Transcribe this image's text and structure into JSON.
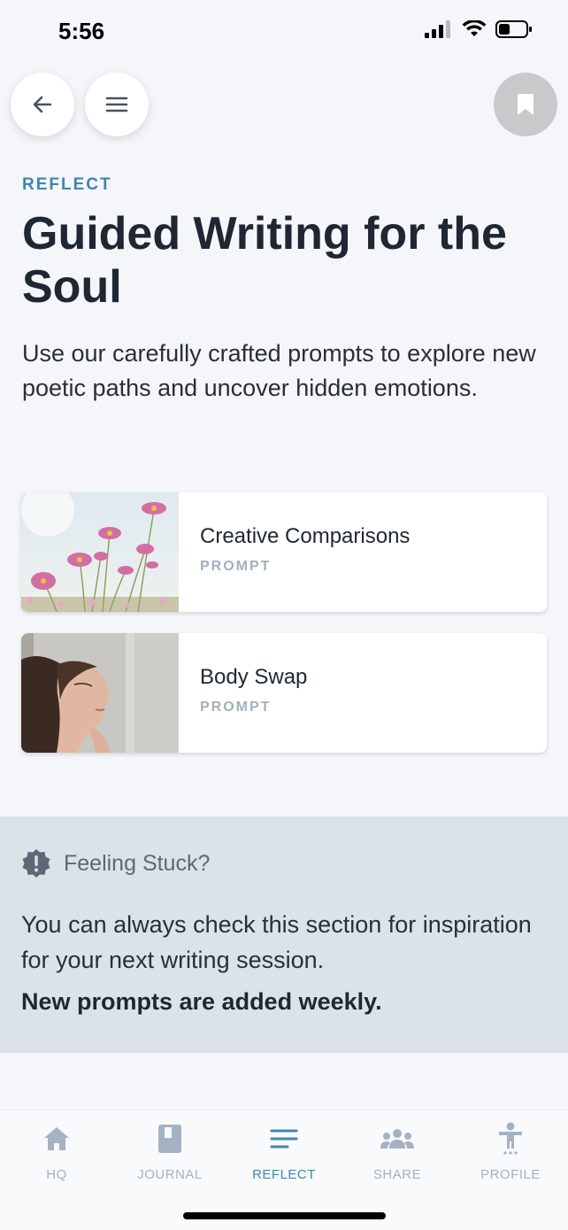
{
  "status_bar": {
    "time": "5:56"
  },
  "header": {
    "eyebrow": "REFLECT",
    "title": "Guided Writing for the Soul",
    "intro": "Use our carefully crafted prompts to explore new poetic paths and uncover hidden emotions."
  },
  "cards": [
    {
      "title": "Creative Comparisons",
      "tag": "PROMPT"
    },
    {
      "title": "Body Swap",
      "tag": "PROMPT"
    }
  ],
  "stuck": {
    "title": "Feeling Stuck?",
    "body": "You can always check this section for inspiration for your next writing session.",
    "strong": "New prompts are added weekly."
  },
  "tabbar": {
    "items": [
      {
        "label": "HQ",
        "icon": "home-icon",
        "active": false
      },
      {
        "label": "JOURNAL",
        "icon": "journal-icon",
        "active": false
      },
      {
        "label": "REFLECT",
        "icon": "reflect-icon",
        "active": true
      },
      {
        "label": "SHARE",
        "icon": "people-icon",
        "active": false
      },
      {
        "label": "PROFILE",
        "icon": "person-icon",
        "active": false
      }
    ]
  },
  "colors": {
    "accent": "#3f86b0",
    "inactive": "#a4b2c4",
    "heading": "#1f2733",
    "stuck_bg": "#dce2ea"
  }
}
